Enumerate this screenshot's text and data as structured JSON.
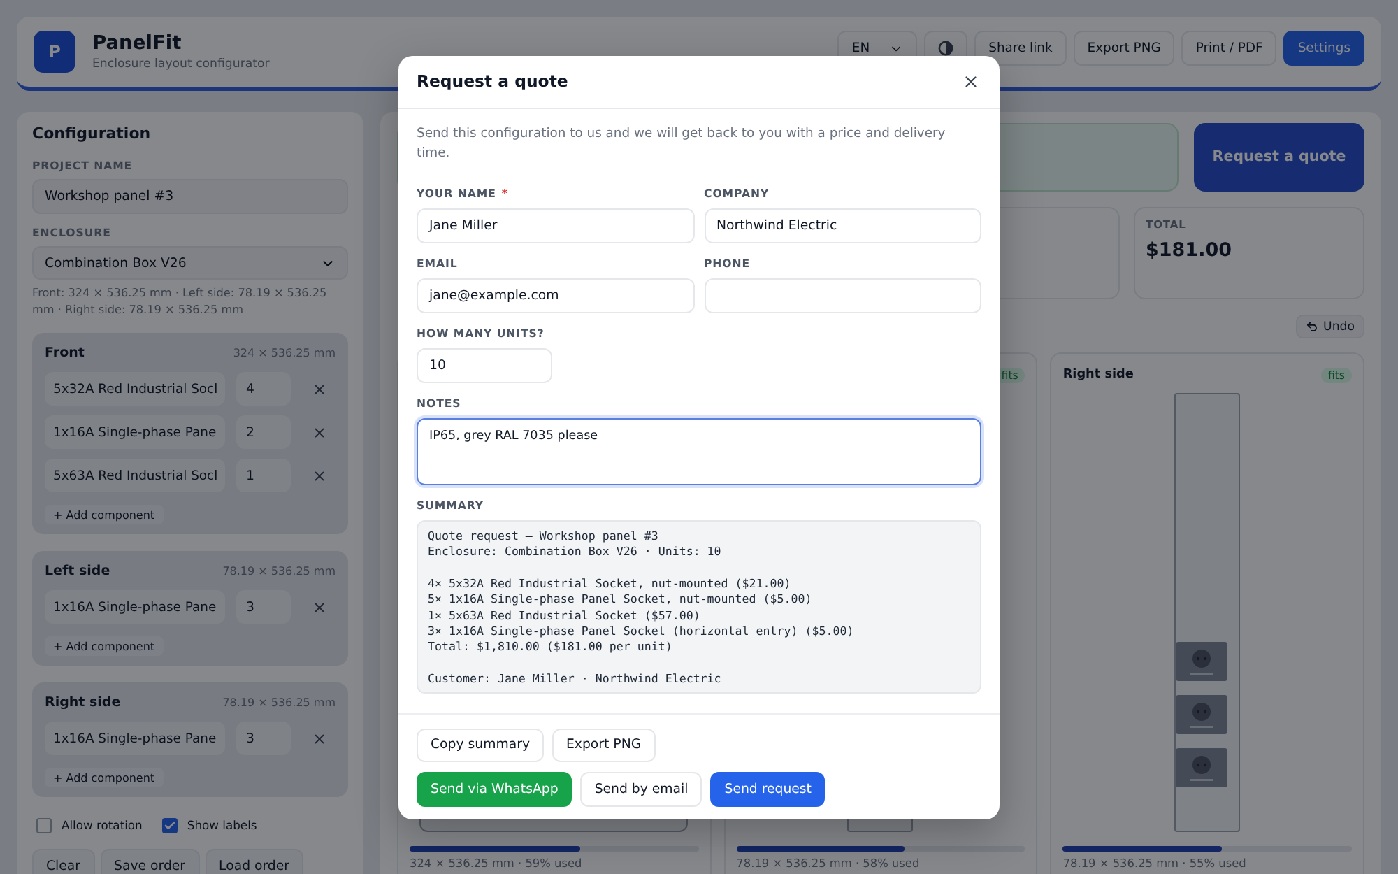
{
  "header": {
    "logo": "P",
    "title": "PanelFit",
    "subtitle": "Enclosure layout configurator",
    "language": "EN",
    "buttons": [
      {
        "label": "Share link",
        "kind": "default"
      },
      {
        "label": "Export PNG",
        "kind": "default"
      },
      {
        "label": "Print / PDF",
        "kind": "default"
      },
      {
        "label": "Settings",
        "kind": "primary"
      }
    ]
  },
  "sidebar": {
    "title": "Configuration",
    "project_name": {
      "label": "PROJECT NAME",
      "value": "Workshop panel #3"
    },
    "enclosure": {
      "label": "ENCLOSURE",
      "value": "Combination Box V26",
      "dimensions": "Front: 324 × 536.25 mm · Left side: 78.19 × 536.25 mm · Right side: 78.19 × 536.25 mm"
    },
    "sections": [
      {
        "name": "Front",
        "size": "324 × 536.25 mm",
        "components": [
          {
            "name": "5x32A Red Industrial Socl",
            "quantity": "4"
          },
          {
            "name": "1x16A Single-phase Pane",
            "quantity": "2"
          },
          {
            "name": "5x63A Red Industrial Socl",
            "quantity": "1"
          }
        ],
        "add_button": "+ Add component"
      },
      {
        "name": "Left side",
        "size": "78.19 × 536.25 mm",
        "components": [
          {
            "name": "1x16A Single-phase Pane",
            "quantity": "3"
          }
        ],
        "add_button": "+ Add component"
      },
      {
        "name": "Right side",
        "size": "78.19 × 536.25 mm",
        "components": [
          {
            "name": "1x16A Single-phase Pane",
            "quantity": "3"
          }
        ],
        "add_button": "+ Add component"
      }
    ],
    "options": [
      {
        "label": "Allow rotation",
        "checked": false
      },
      {
        "label": "Show labels",
        "checked": true
      }
    ],
    "buttons": [
      "Clear",
      "Save order",
      "Load order"
    ]
  },
  "main": {
    "quote_button": "Request a quote",
    "total": {
      "label": "TOTAL",
      "value": "$181.00"
    },
    "undo_button": "Undo",
    "panels": [
      {
        "kind": "front",
        "caption": "324 × 536.25 mm · 59% used",
        "level": 0.59
      },
      {
        "kind": "side",
        "badge": "fits",
        "caption": "78.19 × 536.25 mm · 58% used",
        "level": 0.58
      },
      {
        "kind": "side",
        "title": "Right side",
        "badge": "fits",
        "caption": "78.19 × 536.25 mm · 55% used",
        "level": 0.55,
        "modules": [
          {
            "kind": "socket"
          },
          {
            "kind": "socket"
          },
          {
            "kind": "socket"
          }
        ]
      }
    ]
  },
  "dialog": {
    "title": "Request a quote",
    "intro": "Send this configuration to us and we will get back to you with a price and delivery time.",
    "fields": [
      {
        "label": "YOUR NAME",
        "required_mark": "*",
        "kind": "text",
        "value": "Jane Miller",
        "focused": false
      },
      {
        "label": "COMPANY",
        "kind": "text",
        "value": "Northwind Electric",
        "focused": false
      },
      {
        "label": "EMAIL",
        "kind": "text",
        "value": "jane@example.com",
        "focused": false
      },
      {
        "label": "PHONE",
        "kind": "text",
        "focused": false
      },
      {
        "label": "HOW MANY UNITS?",
        "kind": "number",
        "value": "10",
        "focused": false
      },
      {
        "label": "NOTES",
        "kind": "textarea",
        "value": "IP65, grey RAL 7035 please",
        "focused": true
      }
    ],
    "summary": {
      "label": "SUMMARY",
      "text": "Quote request — Workshop panel #3\nEnclosure: Combination Box V26 · Units: 10\n\n4× 5x32A Red Industrial Socket, nut-mounted ($21.00)\n5× 1x16A Single-phase Panel Socket, nut-mounted ($5.00)\n1× 5x63A Red Industrial Socket ($57.00)\n3× 1x16A Single-phase Panel Socket (horizontal entry) ($5.00)\nTotal: $1,810.00 ($181.00 per unit)\n\nCustomer: Jane Miller · Northwind Electric"
    },
    "actions": [
      {
        "label": "Copy summary",
        "kind": "default"
      },
      {
        "label": "Export PNG",
        "kind": "default"
      }
    ],
    "send_actions": [
      {
        "label": "Send via WhatsApp",
        "kind": "whatsapp"
      },
      {
        "label": "Send by email",
        "kind": "default"
      },
      {
        "label": "Send request",
        "kind": "primary"
      }
    ]
  }
}
